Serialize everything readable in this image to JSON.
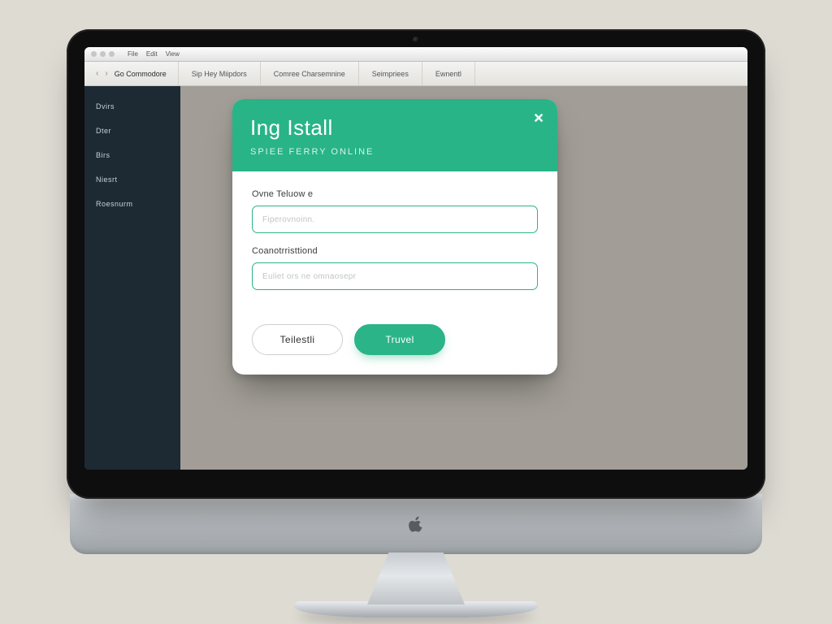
{
  "colors": {
    "accent": "#2bb488",
    "sidebar_bg": "#1d2a34",
    "canvas_bg": "#a29e97"
  },
  "menubar": {
    "items": [
      "File",
      "Edit",
      "View"
    ]
  },
  "tabbar": {
    "address": "Go Commodore",
    "tabs": [
      {
        "label": "Sip Hey Miipdors"
      },
      {
        "label": "Comree Charsemnine"
      },
      {
        "label": "Seimpriees"
      },
      {
        "label": "Ewnentl"
      }
    ]
  },
  "sidebar": {
    "items": [
      {
        "label": "Dvirs"
      },
      {
        "label": "Dter"
      },
      {
        "label": "Birs"
      },
      {
        "label": "Niesrt"
      },
      {
        "label": "Roesnurm"
      }
    ]
  },
  "modal": {
    "title": "Ing Istall",
    "subtitle": "SPIEE FERRY ONLINE",
    "close_icon": "close",
    "field1": {
      "label": "Ovne Teluow e",
      "placeholder": "Fiperovnoinn."
    },
    "field2": {
      "label": "Coanotrristtiond",
      "placeholder": "Euliet ors ne omnaosepr"
    },
    "secondary": "Teilestli",
    "primary": "Truvel"
  }
}
